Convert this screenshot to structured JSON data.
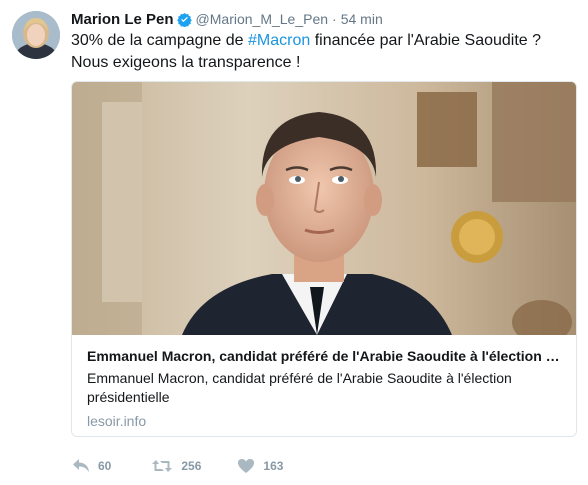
{
  "tweet": {
    "display_name": "Marion Le Pen",
    "handle": "@Marion_M_Le_Pen",
    "separator": "·",
    "time": "54 min",
    "text_before": "30% de la campagne de ",
    "hashtag": "#Macron",
    "text_after_line1": " financée par l'Arabie Saoudite ?",
    "text_line2": "Nous exigeons la transparence !"
  },
  "card": {
    "title": "Emmanuel Macron, candidat préféré de l'Arabie Saoudite à l'élection présidentielle",
    "description": "Emmanuel Macron, candidat préféré de l'Arabie Saoudite à l'élection présidentielle",
    "domain": "lesoir.info"
  },
  "actions": {
    "reply_count": "60",
    "retweet_count": "256",
    "like_count": "163"
  },
  "icons": {
    "verified": "verified-badge-icon",
    "reply": "reply-icon",
    "retweet": "retweet-icon",
    "like": "heart-icon"
  },
  "colors": {
    "link": "#1b95e0",
    "verified": "#1da1f2",
    "muted": "#8899a6"
  }
}
